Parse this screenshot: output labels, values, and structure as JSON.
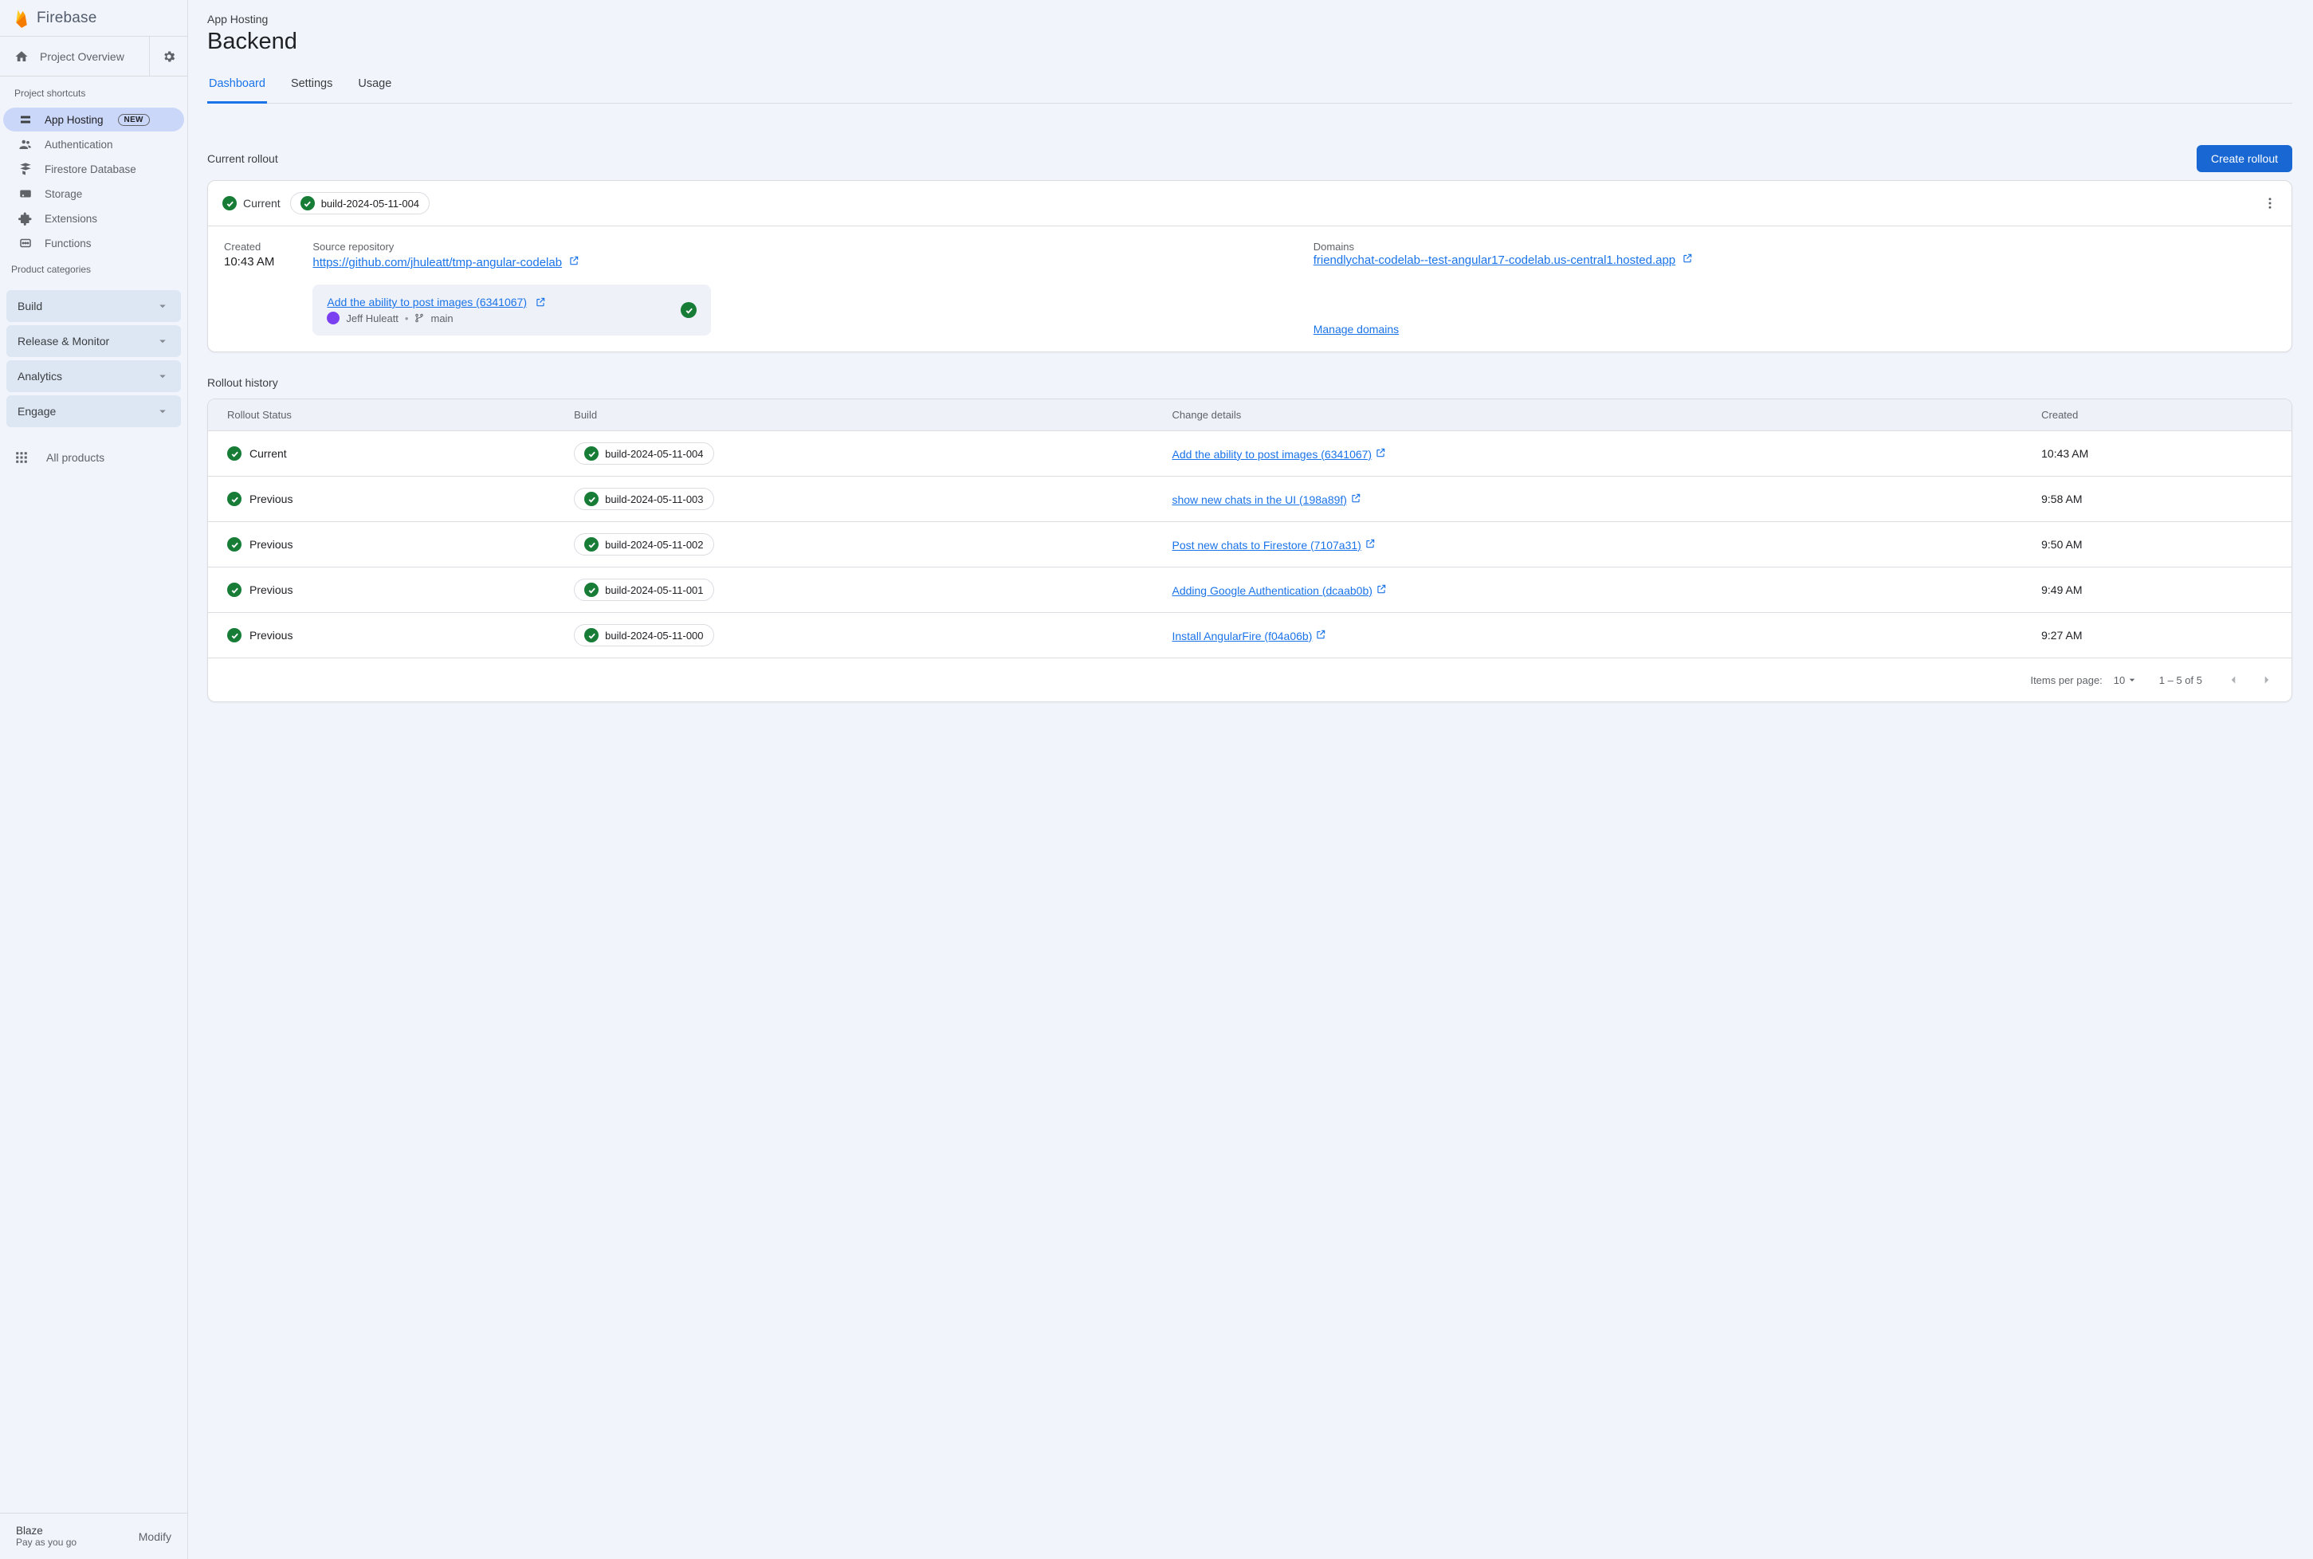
{
  "brand": "Firebase",
  "project_overview": "Project Overview",
  "sidebar": {
    "shortcuts_header": "Project shortcuts",
    "items": [
      {
        "label": "App Hosting",
        "new": "NEW",
        "active": true
      },
      {
        "label": "Authentication"
      },
      {
        "label": "Firestore Database"
      },
      {
        "label": "Storage"
      },
      {
        "label": "Extensions"
      },
      {
        "label": "Functions"
      }
    ],
    "categories_header": "Product categories",
    "categories": [
      {
        "label": "Build"
      },
      {
        "label": "Release & Monitor"
      },
      {
        "label": "Analytics"
      },
      {
        "label": "Engage"
      }
    ],
    "all_products": "All products",
    "plan": {
      "name": "Blaze",
      "desc": "Pay as you go",
      "modify": "Modify"
    }
  },
  "header": {
    "breadcrumb": "App Hosting",
    "title": "Backend",
    "tabs": [
      "Dashboard",
      "Settings",
      "Usage"
    ],
    "active_tab": 0
  },
  "current_rollout": {
    "label": "Current rollout",
    "create_btn": "Create rollout",
    "status": "Current",
    "build": "build-2024-05-11-004",
    "created_label": "Created",
    "created_value": "10:43 AM",
    "repo_label": "Source repository",
    "repo_link": "https://github.com/jhuleatt/tmp-angular-codelab",
    "commit_link": "Add the ability to post images (6341067)",
    "author": "Jeff Huleatt",
    "branch": "main",
    "domains_label": "Domains",
    "domain_link": "friendlychat-codelab--test-angular17-codelab.us-central1.hosted.app",
    "manage_domains": "Manage domains"
  },
  "history": {
    "label": "Rollout history",
    "columns": [
      "Rollout Status",
      "Build",
      "Change details",
      "Created"
    ],
    "rows": [
      {
        "status": "Current",
        "build": "build-2024-05-11-004",
        "change": "Add the ability to post images (6341067)",
        "created": "10:43 AM"
      },
      {
        "status": "Previous",
        "build": "build-2024-05-11-003",
        "change": "show new chats in the UI (198a89f)",
        "created": "9:58 AM"
      },
      {
        "status": "Previous",
        "build": "build-2024-05-11-002",
        "change": "Post new chats to Firestore (7107a31)",
        "created": "9:50 AM"
      },
      {
        "status": "Previous",
        "build": "build-2024-05-11-001",
        "change": "Adding Google Authentication (dcaab0b)",
        "created": "9:49 AM"
      },
      {
        "status": "Previous",
        "build": "build-2024-05-11-000",
        "change": "Install AngularFire (f04a06b)",
        "created": "9:27 AM"
      }
    ],
    "pager": {
      "ipp_label": "Items per page:",
      "ipp_value": "10",
      "range": "1 – 5 of 5"
    }
  }
}
